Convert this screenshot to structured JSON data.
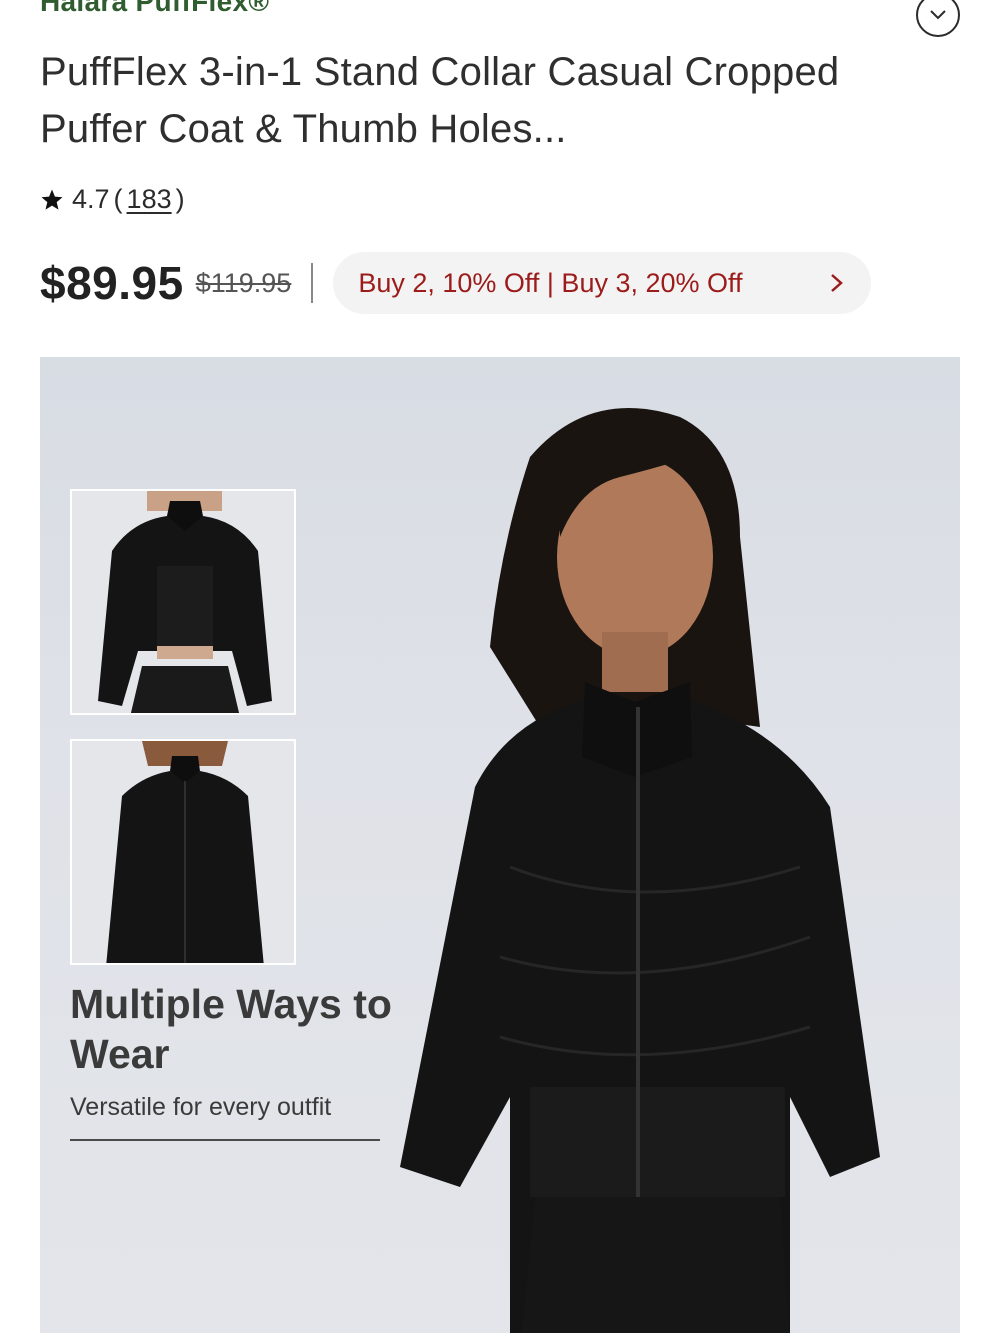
{
  "brand": "Halara PuffFlex®",
  "icons": {
    "expand": "chevron-down-icon",
    "rating": "star-icon",
    "promo": "chevron-right-icon"
  },
  "product": {
    "title": "PuffFlex 3-in-1 Stand Collar Casual Cropped Puffer Coat & Thumb Holes...",
    "rating": "4.7",
    "rating_open": "(",
    "review_count": "183",
    "rating_close": ")",
    "price": "$89.95",
    "original_price": "$119.95",
    "promo": "Buy 2, 10% Off | Buy 3, 20% Off"
  },
  "hero": {
    "heading": "Multiple Ways to Wear",
    "subheading": "Versatile for every outfit"
  },
  "colors": {
    "brand": "#2f5d2f",
    "promo_text": "#9c1b1b",
    "promo_bg": "#f3f3f3",
    "hero_bg": "#dfe2e8"
  }
}
